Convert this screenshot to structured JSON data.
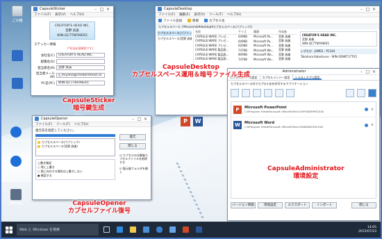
{
  "desktop": {
    "icons": [
      {
        "label": "ごみ箱"
      },
      {
        "label": ""
      },
      {
        "label": ""
      },
      {
        "label": "CapsuleOpener"
      },
      {
        "label": "Sticker"
      },
      {
        "label": "VMware"
      }
    ]
  },
  "sticker": {
    "title": "CapsuleSticker",
    "menu": [
      "ファイル(F)",
      "表示(V)",
      "ヘルプ(H)"
    ],
    "card_lines": [
      "CREATOR'S HEAD INC.",
      "宮野 具美",
      "WIN-QC7TNF99ER5"
    ],
    "section": "ステッカー情報",
    "note": "(*印は必須項目です)",
    "fields": [
      {
        "label": "会社名(C)",
        "value": "CREATOR'S HEAD INC."
      },
      {
        "label": "部署名(D)",
        "value": ""
      },
      {
        "label": "担当者名(N)",
        "value": "宮野 具美"
      },
      {
        "label": "担当者メール(M)",
        "value": "y_miyano@creatorshead.co"
      },
      {
        "label": "PC名(PC)",
        "value": "WIN-QC7TNF99ER5"
      }
    ],
    "caption_line1": "CapsuleSticker",
    "caption_line2": "暗号鍵生成"
  },
  "desktop_app": {
    "title": "CapsuleDesktop",
    "menu": [
      "ファイル(F)",
      "編集(E)",
      "表示(V)",
      "ツール(T)",
      "ヘルプ(H)"
    ],
    "toolbar": [
      "ファイル追加",
      "新規",
      "カプセル化"
    ],
    "path": "カプセルスペース: [¥¥csarsmb¥desktop¥カプセルスペース(パブリック)]",
    "tree": [
      "カプセルスペース(パブリック)",
      "カプセルスペース(宮野 具美)"
    ],
    "columns": [
      "名前",
      "サイズ",
      "種類",
      "作成者"
    ],
    "rows": [
      {
        "name": "CAPSULE-WARE プレゼ...",
        "size": "649KB",
        "type": "Microsoft Po...",
        "author": "宮野 具美"
      },
      {
        "name": "CAPSULE-WARE プレゼ...",
        "size": "649KB",
        "type": "Microsoft Po...",
        "author": "宮野 具美"
      },
      {
        "name": "CAPSULE-WARE プレゼ...",
        "size": "620KB",
        "type": "Microsoft Po...",
        "author": "宮野 具美"
      },
      {
        "name": "CAPSULE-WARE 製品説...",
        "size": "747KB",
        "type": "Microsoft Wo...",
        "author": "宮野 具美"
      },
      {
        "name": "CAPSULE-WARE 製品説...",
        "size": "809KB",
        "type": "Microsoft Wo...",
        "author": "宮野 具美"
      },
      {
        "name": "CAPSULE-WARE 製品説...",
        "size": "747KB",
        "type": "Microsoft Wo...",
        "author": "宮野 具美"
      }
    ],
    "card_lines": [
      "CREATOR'S HEAD INC.",
      "宮野 具美",
      "WIN-QC7TNF99ER5"
    ],
    "members": [
      "いずれか - JAMES - PC184",
      "Takahara Kabutsune - WIN-OEN6T17TU5"
    ],
    "caption_line1": "CapsuleDesktop",
    "caption_line2": "カプセルスペース運用＆暗号ファイル生成"
  },
  "opener": {
    "title": "CapsuleOpener",
    "menu": [
      "ファイル(F)",
      "ツール(T)",
      "ヘルプ(H)"
    ],
    "prompt": "復元先を指定してください。",
    "list": [
      "カプセルスペース(パブリック)",
      "カプセルスペース(宮野 具美)"
    ],
    "restore_btn": "復元",
    "close_btn": "閉じる",
    "check1": "カプセルの分解後カプセルファイルを削除する",
    "check2": "復元後フォルダを開く",
    "overwrite_label": "上書き確認",
    "radios": [
      "常に上書き",
      "既に存在する場合は上書きしない",
      "確認する"
    ],
    "caption_line1": "CapsuleOpener",
    "caption_line2": "カプセルファイル復号"
  },
  "admin": {
    "title": "Administrator",
    "tabs": [
      "カプセルスペース設定",
      "カプセルメンバー設定",
      "トラストアプリ設定"
    ],
    "section": "カプセルスペース内でカプセル化を許可するアプリケーション",
    "apps": [
      {
        "name": "Microsoft PowerPoint",
        "path": "C:¥Program Files¥Microsoft Office¥Office15¥POWERPNT.EXE",
        "color": "#d24726",
        "letter": "P"
      },
      {
        "name": "Microsoft Word",
        "path": "C:¥Program Files¥Microsoft Office¥Office15¥WINWORD.EXE",
        "color": "#2b579a",
        "letter": "W"
      }
    ],
    "buttons": [
      "バージョン情報",
      "環境設定",
      "エクスポート",
      "インポート",
      "閉じる"
    ],
    "caption_line1": "CapsuleAdministrator",
    "caption_line2": "環境設定"
  },
  "taskbar": {
    "search": "Web と Windows を検索",
    "time": "14:05",
    "date": "2015/07/23"
  },
  "colors": {
    "caption_red": "#e0191f",
    "accent_blue": "#3a7fd0",
    "taskbar": "#1e2a3a"
  }
}
